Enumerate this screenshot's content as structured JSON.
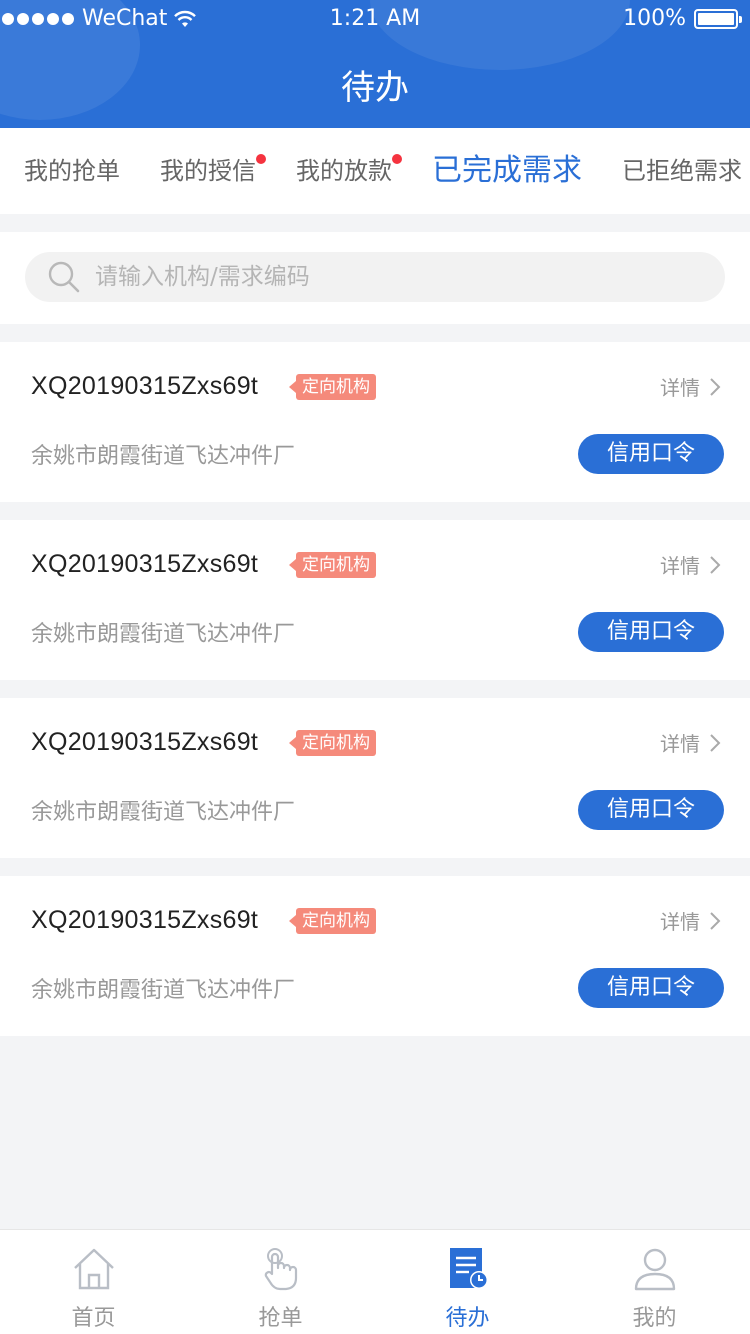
{
  "status_bar": {
    "carrier": "WeChat",
    "time": "1:21 AM",
    "battery": "100%"
  },
  "header": {
    "title": "待办"
  },
  "tabs": [
    {
      "label": "我的抢单",
      "badge": false,
      "active": false
    },
    {
      "label": "我的授信",
      "badge": true,
      "active": false
    },
    {
      "label": "我的放款",
      "badge": true,
      "active": false
    },
    {
      "label": "已完成需求",
      "badge": false,
      "active": true
    },
    {
      "label": "已拒绝需求",
      "badge": false,
      "active": false
    }
  ],
  "search": {
    "placeholder": "请输入机构/需求编码",
    "value": ""
  },
  "cards": [
    {
      "code": "XQ20190315Zxs69t",
      "tag": "定向机构",
      "detail": "详情",
      "company": "余姚市朗霞街道飞达冲件厂",
      "action": "信用口令"
    },
    {
      "code": "XQ20190315Zxs69t",
      "tag": "定向机构",
      "detail": "详情",
      "company": "余姚市朗霞街道飞达冲件厂",
      "action": "信用口令"
    },
    {
      "code": "XQ20190315Zxs69t",
      "tag": "定向机构",
      "detail": "详情",
      "company": "余姚市朗霞街道飞达冲件厂",
      "action": "信用口令"
    },
    {
      "code": "XQ20190315Zxs69t",
      "tag": "定向机构",
      "detail": "详情",
      "company": "余姚市朗霞街道飞达冲件厂",
      "action": "信用口令"
    }
  ],
  "bottom_nav": [
    {
      "label": "首页",
      "icon": "home-icon",
      "active": false
    },
    {
      "label": "抢单",
      "icon": "tap-hand-icon",
      "active": false
    },
    {
      "label": "待办",
      "icon": "todo-list-icon",
      "active": true
    },
    {
      "label": "我的",
      "icon": "user-icon",
      "active": false
    }
  ],
  "colors": {
    "primary": "#2a6fd6",
    "tag": "#f58a7b",
    "badge": "#f5333f",
    "background": "#f3f4f6"
  }
}
